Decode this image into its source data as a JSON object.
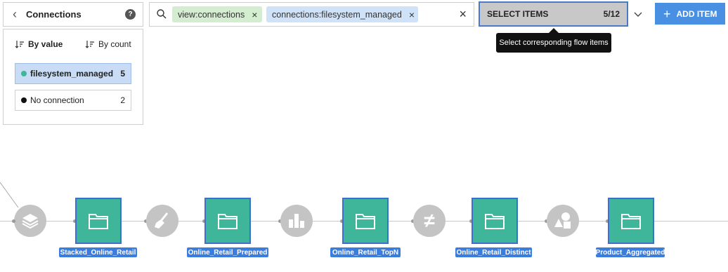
{
  "panel": {
    "back_glyph": "‹",
    "title": "Connections",
    "help_glyph": "?",
    "sort_by_value": "By value",
    "sort_by_count": "By count",
    "items": [
      {
        "label": "filesystem_managed",
        "count": "5",
        "dot_color": "#3fb59a",
        "selected": true
      },
      {
        "label": "No connection",
        "count": "2",
        "dot_color": "#111111",
        "selected": false
      }
    ]
  },
  "search": {
    "chips": [
      {
        "label": "view:connections",
        "remove": "×"
      },
      {
        "label": "connections:filesystem_managed",
        "remove": "×"
      }
    ],
    "clear": "×"
  },
  "select_items": {
    "label": "SELECT ITEMS",
    "count": "5/12",
    "dropdown_glyph": "⌄",
    "tooltip": "Select corresponding flow items"
  },
  "add_item": {
    "plus": "+",
    "label": "ADD ITEM"
  },
  "flow": {
    "recipes": [
      "stack-icon",
      "clean-brush-icon",
      "bar-chart-icon",
      "not-equal-icon",
      "shapes-icon"
    ],
    "datasets": [
      {
        "label": "Stacked_Online_Retail"
      },
      {
        "label": "Online_Retail_Prepared"
      },
      {
        "label": "Online_Retail_TopN"
      },
      {
        "label": "Online_Retail_Distinct"
      },
      {
        "label": "Product_Aggregated"
      }
    ],
    "not_equal_glyph": "≠"
  },
  "colors": {
    "dataset_fill": "#3fb59a",
    "dataset_border": "#3d6fd0",
    "recipe_fill": "#c4c4c4",
    "accent": "#4a90e2"
  }
}
